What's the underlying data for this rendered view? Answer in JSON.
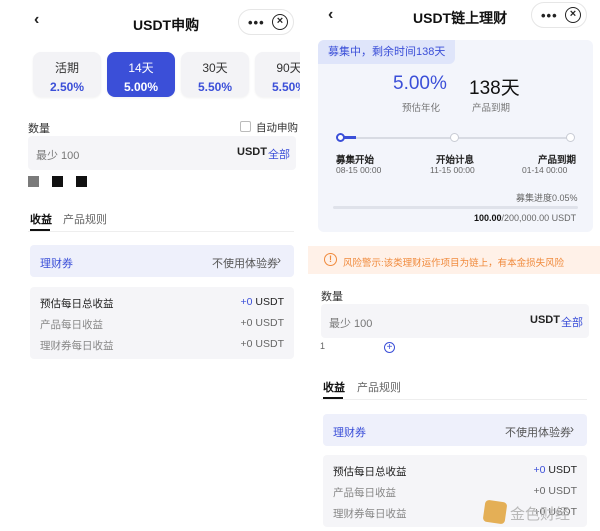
{
  "left": {
    "nav": {
      "back": "‹",
      "title": "USDT申购",
      "more": "•••",
      "close": "⊗"
    },
    "terms": [
      {
        "name": "活期",
        "rate": "2.50%"
      },
      {
        "name": "14天",
        "rate": "5.00%"
      },
      {
        "name": "30天",
        "rate": "5.50%"
      },
      {
        "name": "90天",
        "rate": "5.50%"
      }
    ],
    "amount_label": "数量",
    "auto_subscribe": "自动申购",
    "input": {
      "placeholder": "最少 100",
      "unit": "USDT",
      "all": "全部"
    },
    "swatch_colors": [
      "#7a7a7a",
      "#111111",
      "#111111"
    ],
    "tabs": [
      "收益",
      "产品规则"
    ],
    "coupon": {
      "name": "理财券",
      "value": "不使用体验券",
      "arrow": "›"
    },
    "earnings": [
      {
        "label": "预估每日总收益",
        "value_prefix": "+0",
        "value_unit": " USDT"
      },
      {
        "label": "产品每日收益",
        "value": "+0 USDT"
      },
      {
        "label": "理财券每日收益",
        "value": "+0 USDT"
      }
    ]
  },
  "right": {
    "nav": {
      "back": "‹",
      "title": "USDT链上理财",
      "more": "•••",
      "close": "⊗"
    },
    "status": "募集中，剩余时间138天",
    "rate": "5.00%",
    "rate_caption": "预估年化",
    "days": "138天",
    "days_caption": "产品到期",
    "milestones": [
      {
        "name": "募集开始",
        "date": "08-15 00:00"
      },
      {
        "name": "开始计息",
        "date": "11-15 00:00"
      },
      {
        "name": "产品到期",
        "date": "01-14 00:00"
      }
    ],
    "progress_text": "募集进度0.05%",
    "progress_fraction": 0.0005,
    "raised": "100.00",
    "target": "/200,000.00 USDT",
    "warning": "风险警示:该类理财运作项目为链上，有本金损失风险",
    "warning_icon": "!",
    "amount_label": "数量",
    "input": {
      "placeholder": "最少 100",
      "unit": "USDT",
      "all": "全部"
    },
    "stepper_value": "1",
    "plus": "+",
    "tabs": [
      "收益",
      "产品规则"
    ],
    "coupon": {
      "name": "理财券",
      "value": "不使用体验券",
      "arrow": "›"
    },
    "earnings": [
      {
        "label": "预估每日总收益",
        "value_prefix": "+0",
        "value_unit": " USDT"
      },
      {
        "label": "产品每日收益",
        "value": "+0 USDT"
      },
      {
        "label": "理财券每日收益",
        "value": "+0 USDT"
      }
    ],
    "watermark": "金色财经",
    "colors": {
      "accent": "#3b4fd8",
      "warning": "#f08a3c",
      "watermark_logo": "#e0a23a"
    }
  }
}
